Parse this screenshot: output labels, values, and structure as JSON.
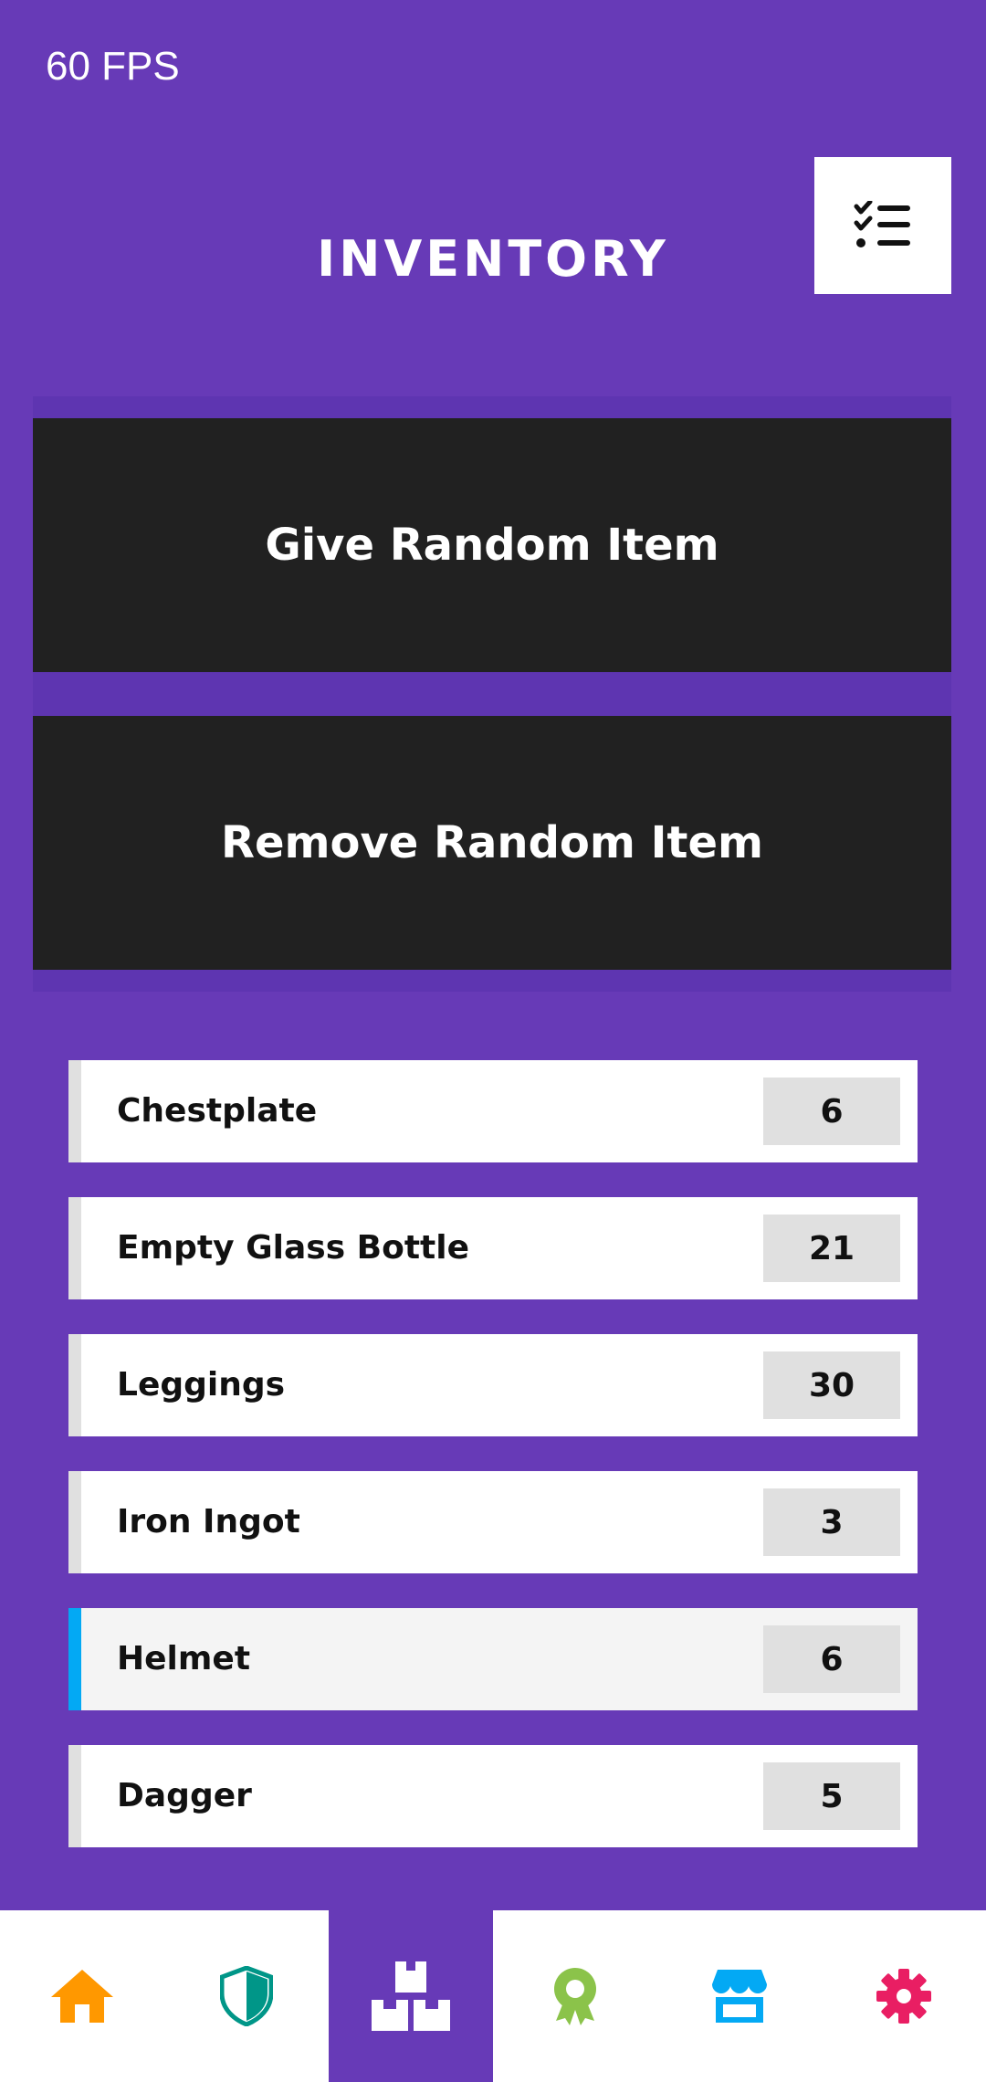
{
  "hud": {
    "fps": "60 FPS"
  },
  "header": {
    "title": "INVENTORY",
    "menu_icon": "checklist-icon"
  },
  "actions": {
    "give_label": "Give Random Item",
    "remove_label": "Remove Random Item"
  },
  "inventory": {
    "items": [
      {
        "name": "Chestplate",
        "quantity": "6",
        "selected": false
      },
      {
        "name": "Empty Glass Bottle",
        "quantity": "21",
        "selected": false
      },
      {
        "name": "Leggings",
        "quantity": "30",
        "selected": false
      },
      {
        "name": "Iron Ingot",
        "quantity": "3",
        "selected": false
      },
      {
        "name": "Helmet",
        "quantity": "6",
        "selected": true
      },
      {
        "name": "Dagger",
        "quantity": "5",
        "selected": false
      }
    ]
  },
  "bottom_nav": {
    "items": [
      {
        "icon": "home-icon",
        "color": "#FF9800",
        "active": false
      },
      {
        "icon": "shield-icon",
        "color": "#009688",
        "active": false
      },
      {
        "icon": "inventory-boxes-icon",
        "color": "#FFFFFF",
        "active": true
      },
      {
        "icon": "award-icon",
        "color": "#8BC34A",
        "active": false
      },
      {
        "icon": "store-icon",
        "color": "#03A9F4",
        "active": false
      },
      {
        "icon": "gear-icon",
        "color": "#E91E63",
        "active": false
      }
    ]
  },
  "colors": {
    "background": "#673AB7",
    "button": "#212121",
    "selected_accent": "#03A9F4"
  }
}
